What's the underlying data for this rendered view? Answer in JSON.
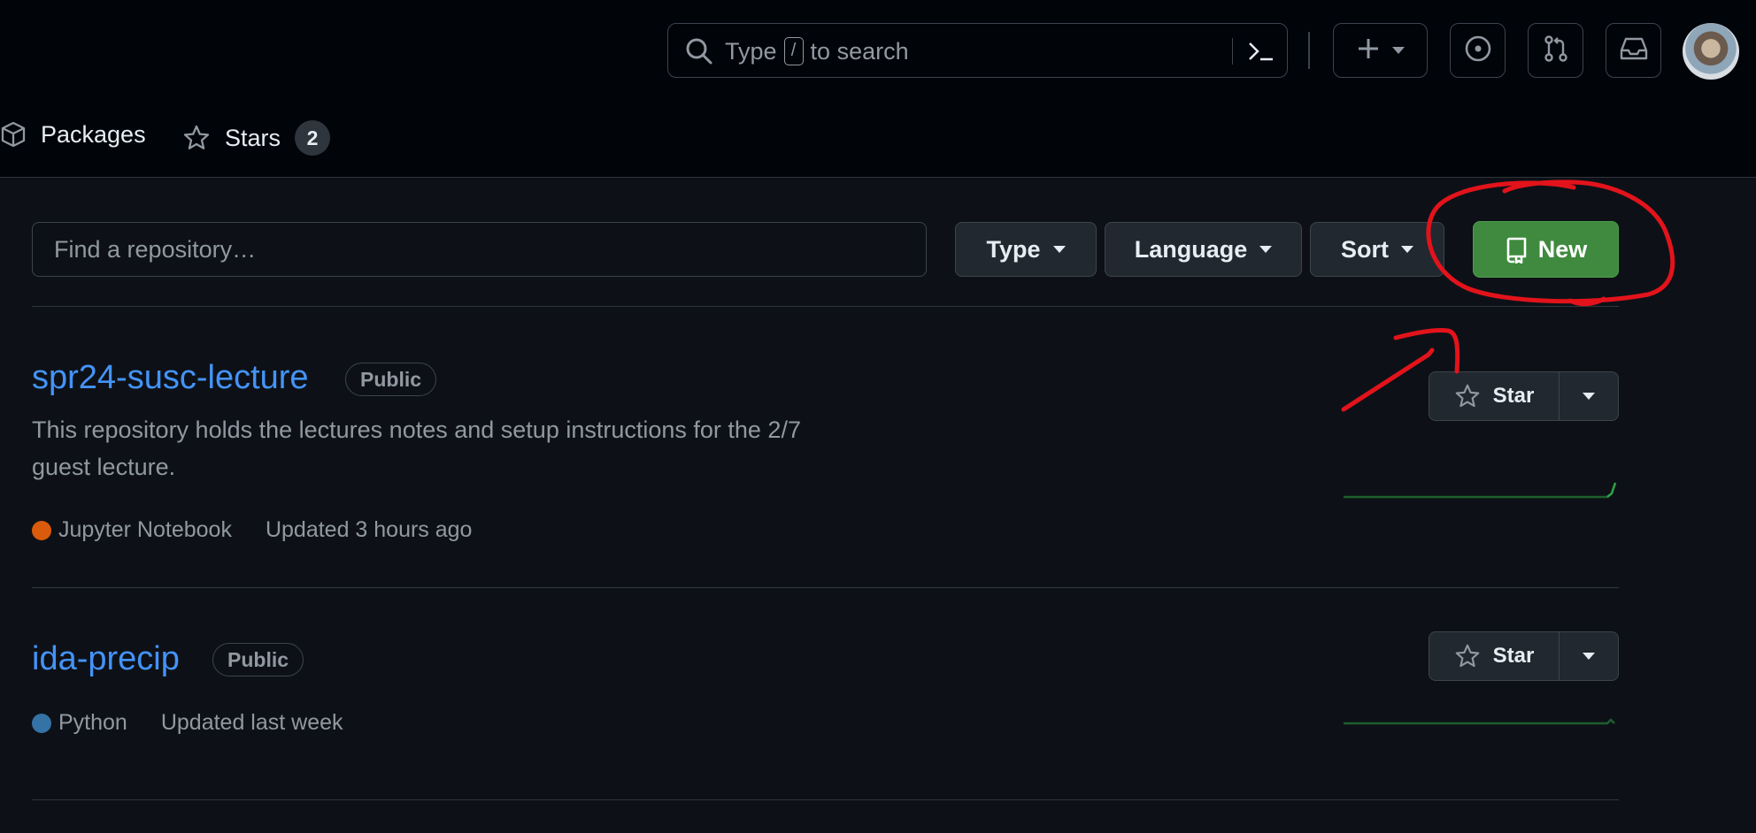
{
  "header": {
    "search": {
      "prefix": "Type",
      "key": "/",
      "suffix": "to search"
    },
    "icons": [
      "search-icon",
      "command-palette-icon",
      "plus-icon",
      "issues-icon",
      "pull-requests-icon",
      "inbox-icon"
    ]
  },
  "nav": {
    "packages_label": "Packages",
    "stars_label": "Stars",
    "stars_count": "2"
  },
  "filters": {
    "find_placeholder": "Find a repository…",
    "type_label": "Type",
    "language_label": "Language",
    "sort_label": "Sort",
    "new_label": "New"
  },
  "repos": [
    {
      "name": "spr24-susc-lecture",
      "visibility": "Public",
      "description_lines": [
        "This repository holds the lectures notes and setup instructions for the 2/7",
        "guest lecture."
      ],
      "language": "Jupyter Notebook",
      "language_color": "#DA5B0B",
      "updated": "Updated 3 hours ago",
      "star_label": "Star"
    },
    {
      "name": "ida-precip",
      "visibility": "Public",
      "description_lines": [],
      "language": "Python",
      "language_color": "#3572A5",
      "updated": "Updated last week",
      "star_label": "Star"
    }
  ],
  "colors": {
    "background": "#0d1117",
    "header_bg": "#010409",
    "link": "#4493f8",
    "new_button": "#3f8a3e",
    "annotation": "#e3131b",
    "sparkline": "#2ea043"
  }
}
